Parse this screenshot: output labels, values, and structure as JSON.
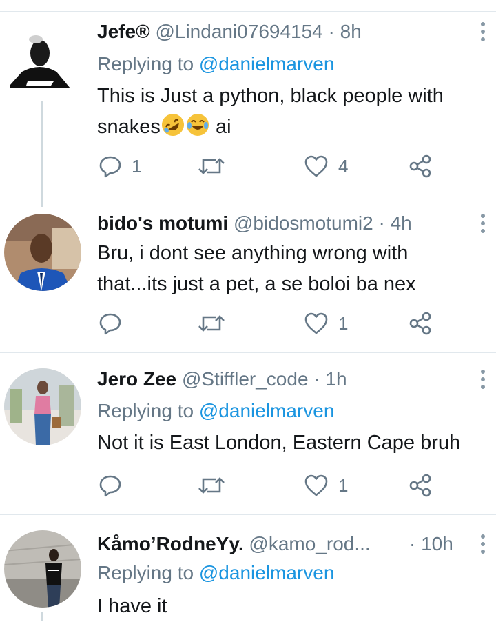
{
  "tweets": [
    {
      "name": "Jefe®",
      "handle": "@Lindani07694154",
      "time": "8h",
      "replying_prefix": "Replying to",
      "replying_to": "@danielmarven",
      "text_line1": "This is Just a python, black people with",
      "text_line2_a": "snakes",
      "text_line2_b": " ai",
      "emojis": [
        "rolling-on-floor-laughing-icon",
        "tears-of-joy-icon"
      ],
      "replies": "1",
      "retweets": "",
      "likes": "4"
    },
    {
      "name": "bido's motumi",
      "handle": "@bidosmotumi2",
      "time": "4h",
      "text_line1": "Bru, i dont see anything wrong with",
      "text_line2": "that...its just a pet, a se boloi ba nex",
      "replies": "",
      "retweets": "",
      "likes": "1"
    },
    {
      "name": "Jero Zee",
      "handle": "@Stiffler_code",
      "time": "1h",
      "replying_prefix": "Replying to",
      "replying_to": "@danielmarven",
      "text_line1": "Not it is East London, Eastern Cape bruh",
      "replies": "",
      "retweets": "",
      "likes": "1"
    },
    {
      "name": "KåmoʼRodneYy.",
      "handle": "@kamo_rod...",
      "time": "10h",
      "replying_prefix": "Replying to",
      "replying_to": "@danielmarven",
      "text_line1": "I have it"
    }
  ],
  "separator_dot": "·",
  "colors": {
    "text": "#14171a",
    "secondary": "#657786",
    "link": "#1b95e0",
    "divider": "#e1e8ed",
    "thread_line": "#cfd9de"
  }
}
